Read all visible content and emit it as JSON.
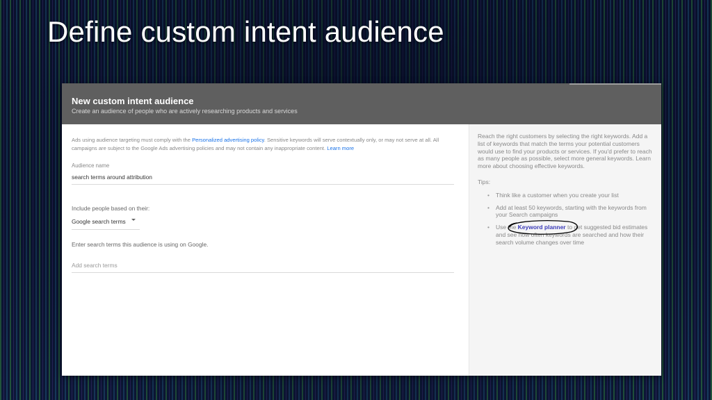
{
  "slide": {
    "title": "Define custom intent audience"
  },
  "dialog": {
    "title": "New custom intent audience",
    "subtitle": "Create an audience of people who are actively researching products and services"
  },
  "policy": {
    "text_before": "Ads using audience targeting must comply with the ",
    "link_policy": "Personalized advertising policy",
    "text_after": ". Sensitive keywords will serve contextually only, or may not serve at all. All campaigns are subject to the Google Ads advertising policies and may not contain any inappropriate content. ",
    "link_learn": "Learn more"
  },
  "audience_name": {
    "label": "Audience name",
    "value": "search terms around attribution"
  },
  "include": {
    "label": "Include people based on their:",
    "selected": "Google search terms"
  },
  "search_terms": {
    "instruction": "Enter search terms this audience is using on Google.",
    "placeholder": "Add search terms"
  },
  "sidebar": {
    "intro": "Reach the right customers by selecting the right keywords. Add a list of keywords that match the terms your potential customers would use to find your products or services. If you'd prefer to reach as many people as possible, select more general keywords. Learn more about choosing effective keywords.",
    "tips_heading": "Tips:",
    "tip1": "Think like a customer when you create your list",
    "tip2": "Add at least 50 keywords, starting with the keywords from your Search campaigns",
    "tip3_before": "Use the ",
    "tip3_link": "Keyword planner",
    "tip3_after": " to get suggested bid estimates and see how often keywords are searched and how their search volume changes over time"
  },
  "colors": {
    "header": "#5f5f5f",
    "link": "#1a73e8",
    "annotation_circle": "#000000"
  }
}
